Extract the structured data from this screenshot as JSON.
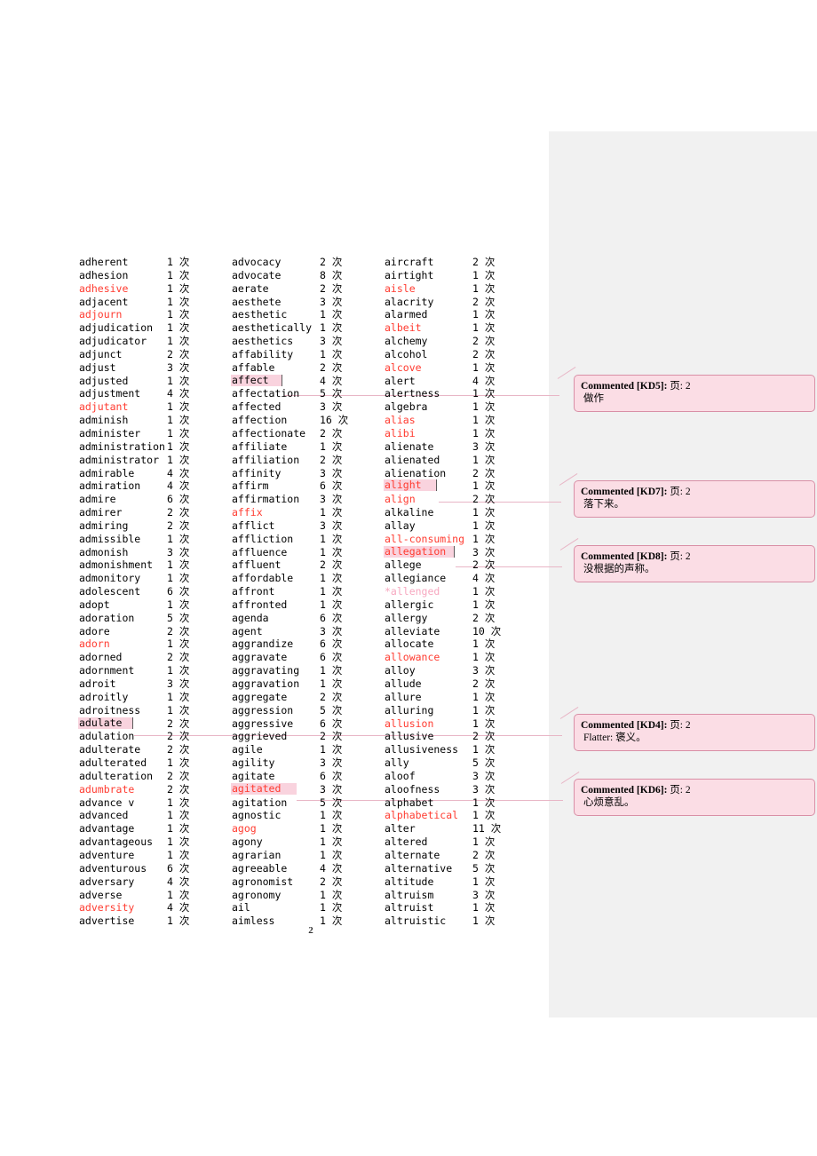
{
  "document": {
    "page_number": "2",
    "count_suffix": "次"
  },
  "columns": [
    {
      "id": "column-1",
      "entries": [
        {
          "term": "adherent",
          "count": "1 次",
          "style": "normal"
        },
        {
          "term": "adhesion",
          "count": "1 次",
          "style": "normal"
        },
        {
          "term": "adhesive",
          "count": "1 次",
          "style": "red"
        },
        {
          "term": "adjacent",
          "count": "1 次",
          "style": "normal"
        },
        {
          "term": "adjourn",
          "count": "1 次",
          "style": "red"
        },
        {
          "term": "adjudication",
          "count": "1 次",
          "style": "normal"
        },
        {
          "term": "adjudicator",
          "count": "1 次",
          "style": "normal"
        },
        {
          "term": "adjunct",
          "count": "2 次",
          "style": "normal"
        },
        {
          "term": "adjust",
          "count": "3 次",
          "style": "normal"
        },
        {
          "term": "adjusted",
          "count": "1 次",
          "style": "normal"
        },
        {
          "term": "adjustment",
          "count": "4 次",
          "style": "normal"
        },
        {
          "term": "adjutant",
          "count": "1 次",
          "style": "red"
        },
        {
          "term": "adminish",
          "count": "1 次",
          "style": "normal"
        },
        {
          "term": "administer",
          "count": "1 次",
          "style": "normal"
        },
        {
          "term": "administration",
          "count": "1 次",
          "style": "normal"
        },
        {
          "term": "administrator",
          "count": "1 次",
          "style": "normal"
        },
        {
          "term": "admirable",
          "count": "4 次",
          "style": "normal"
        },
        {
          "term": "admiration",
          "count": "4 次",
          "style": "normal"
        },
        {
          "term": "admire",
          "count": "6 次",
          "style": "normal"
        },
        {
          "term": "admirer",
          "count": "2 次",
          "style": "normal"
        },
        {
          "term": "admiring",
          "count": "2 次",
          "style": "normal"
        },
        {
          "term": "admissible",
          "count": "1 次",
          "style": "normal"
        },
        {
          "term": "admonish",
          "count": "3 次",
          "style": "normal"
        },
        {
          "term": "admonishment",
          "count": "1 次",
          "style": "normal"
        },
        {
          "term": "admonitory",
          "count": "1 次",
          "style": "normal"
        },
        {
          "term": "adolescent",
          "count": "6 次",
          "style": "normal"
        },
        {
          "term": "adopt",
          "count": "1 次",
          "style": "normal"
        },
        {
          "term": "adoration",
          "count": "5 次",
          "style": "normal"
        },
        {
          "term": "adore",
          "count": "2 次",
          "style": "normal"
        },
        {
          "term": "adorn",
          "count": "1 次",
          "style": "red"
        },
        {
          "term": "adorned",
          "count": "2 次",
          "style": "normal"
        },
        {
          "term": "adornment",
          "count": "1 次",
          "style": "normal"
        },
        {
          "term": "adroit",
          "count": "3 次",
          "style": "normal"
        },
        {
          "term": "adroitly",
          "count": "1 次",
          "style": "normal"
        },
        {
          "term": "adroitness",
          "count": "1 次",
          "style": "normal"
        },
        {
          "term": "adulate",
          "count": "2 次",
          "style": "highlight",
          "hl_width": 62
        },
        {
          "term": "adulation",
          "count": "2 次",
          "style": "normal"
        },
        {
          "term": "adulterate",
          "count": "2 次",
          "style": "normal"
        },
        {
          "term": "adulterated",
          "count": "1 次",
          "style": "normal"
        },
        {
          "term": "adulteration",
          "count": "2 次",
          "style": "normal"
        },
        {
          "term": "adumbrate",
          "count": "2 次",
          "style": "red"
        },
        {
          "term": "advance v",
          "count": "1 次",
          "style": "normal"
        },
        {
          "term": "advanced",
          "count": "1 次",
          "style": "normal"
        },
        {
          "term": "advantage",
          "count": "1 次",
          "style": "normal"
        },
        {
          "term": "advantageous",
          "count": "1 次",
          "style": "normal"
        },
        {
          "term": "adventure",
          "count": "1 次",
          "style": "normal"
        },
        {
          "term": "adventurous",
          "count": "6 次",
          "style": "normal"
        },
        {
          "term": "adversary",
          "count": "4 次",
          "style": "normal"
        },
        {
          "term": "adverse",
          "count": "1 次",
          "style": "normal"
        },
        {
          "term": "adversity",
          "count": "4 次",
          "style": "red"
        },
        {
          "term": "advertise",
          "count": "1 次",
          "style": "normal"
        }
      ]
    },
    {
      "id": "column-2",
      "entries": [
        {
          "term": "advocacy",
          "count": "2 次",
          "style": "normal"
        },
        {
          "term": "advocate",
          "count": "8 次",
          "style": "normal"
        },
        {
          "term": "aerate",
          "count": "2 次",
          "style": "normal"
        },
        {
          "term": "aesthete",
          "count": "3 次",
          "style": "normal"
        },
        {
          "term": "aesthetic",
          "count": "1 次",
          "style": "normal"
        },
        {
          "term": "aesthetically",
          "count": "1 次",
          "style": "normal"
        },
        {
          "term": "aesthetics",
          "count": "3 次",
          "style": "normal"
        },
        {
          "term": "affability",
          "count": "1 次",
          "style": "normal"
        },
        {
          "term": "affable",
          "count": "2 次",
          "style": "normal"
        },
        {
          "term": "affect",
          "count": "4 次",
          "style": "highlight",
          "hl_width": 58
        },
        {
          "term": "affectation",
          "count": "5 次",
          "style": "normal"
        },
        {
          "term": "affected",
          "count": "3 次",
          "style": "normal"
        },
        {
          "term": "affection",
          "count": "16 次",
          "style": "normal"
        },
        {
          "term": "affectionate",
          "count": "2 次",
          "style": "normal"
        },
        {
          "term": "affiliate",
          "count": "1 次",
          "style": "normal"
        },
        {
          "term": "affiliation",
          "count": "2 次",
          "style": "normal"
        },
        {
          "term": "affinity",
          "count": "3 次",
          "style": "normal"
        },
        {
          "term": "affirm",
          "count": "6 次",
          "style": "normal"
        },
        {
          "term": "affirmation",
          "count": "3 次",
          "style": "normal"
        },
        {
          "term": "affix",
          "count": "1 次",
          "style": "red"
        },
        {
          "term": "afflict",
          "count": "3 次",
          "style": "normal"
        },
        {
          "term": "affliction",
          "count": "1 次",
          "style": "normal"
        },
        {
          "term": "affluence",
          "count": "1 次",
          "style": "normal"
        },
        {
          "term": "affluent",
          "count": "2 次",
          "style": "normal"
        },
        {
          "term": "affordable",
          "count": "1 次",
          "style": "normal"
        },
        {
          "term": "affront",
          "count": "1 次",
          "style": "normal"
        },
        {
          "term": "affronted",
          "count": "1 次",
          "style": "normal"
        },
        {
          "term": "agenda",
          "count": "6 次",
          "style": "normal"
        },
        {
          "term": "agent",
          "count": "3 次",
          "style": "normal"
        },
        {
          "term": "aggrandize",
          "count": "6 次",
          "style": "normal"
        },
        {
          "term": "aggravate",
          "count": "6 次",
          "style": "normal"
        },
        {
          "term": "aggravating",
          "count": "1 次",
          "style": "normal"
        },
        {
          "term": "aggravation",
          "count": "1 次",
          "style": "normal"
        },
        {
          "term": "aggregate",
          "count": "2 次",
          "style": "normal"
        },
        {
          "term": "aggression",
          "count": "5 次",
          "style": "normal"
        },
        {
          "term": "aggressive",
          "count": "6 次",
          "style": "normal"
        },
        {
          "term": "aggrieved",
          "count": "2 次",
          "style": "normal"
        },
        {
          "term": "agile",
          "count": "1 次",
          "style": "normal"
        },
        {
          "term": "agility",
          "count": "3 次",
          "style": "normal"
        },
        {
          "term": "agitate",
          "count": "6 次",
          "style": "normal"
        },
        {
          "term": "agitated",
          "count": "3 次",
          "style": "highlight-red",
          "hl_width": 74
        },
        {
          "term": "agitation",
          "count": "5 次",
          "style": "normal"
        },
        {
          "term": "agnostic",
          "count": "1 次",
          "style": "normal"
        },
        {
          "term": "agog",
          "count": "1 次",
          "style": "red"
        },
        {
          "term": "agony",
          "count": "1 次",
          "style": "normal"
        },
        {
          "term": "agrarian",
          "count": "1 次",
          "style": "normal"
        },
        {
          "term": "agreeable",
          "count": "4 次",
          "style": "normal"
        },
        {
          "term": "agronomist",
          "count": "2 次",
          "style": "normal"
        },
        {
          "term": "agronomy",
          "count": "1 次",
          "style": "normal"
        },
        {
          "term": "ail",
          "count": "1 次",
          "style": "normal"
        },
        {
          "term": "aimless",
          "count": "1 次",
          "style": "normal"
        }
      ]
    },
    {
      "id": "column-3",
      "entries": [
        {
          "term": "aircraft",
          "count": "2 次",
          "style": "normal"
        },
        {
          "term": "airtight",
          "count": "1 次",
          "style": "normal"
        },
        {
          "term": "aisle",
          "count": "1 次",
          "style": "red"
        },
        {
          "term": "alacrity",
          "count": "2 次",
          "style": "normal"
        },
        {
          "term": "alarmed",
          "count": "1 次",
          "style": "normal"
        },
        {
          "term": "albeit",
          "count": "1 次",
          "style": "red"
        },
        {
          "term": "alchemy",
          "count": "2 次",
          "style": "normal"
        },
        {
          "term": "alcohol",
          "count": "2 次",
          "style": "normal"
        },
        {
          "term": "alcove",
          "count": "1 次",
          "style": "red"
        },
        {
          "term": "alert",
          "count": "4 次",
          "style": "normal"
        },
        {
          "term": "alertness",
          "count": "1 次",
          "style": "normal"
        },
        {
          "term": "algebra",
          "count": "1 次",
          "style": "normal"
        },
        {
          "term": "alias",
          "count": "1 次",
          "style": "red"
        },
        {
          "term": "alibi",
          "count": "1 次",
          "style": "red"
        },
        {
          "term": "alienate",
          "count": "3 次",
          "style": "normal"
        },
        {
          "term": "alienated",
          "count": "1 次",
          "style": "normal"
        },
        {
          "term": "alienation",
          "count": "2 次",
          "style": "normal"
        },
        {
          "term": "alight",
          "count": "1 次",
          "style": "highlight-red",
          "hl_width": 60
        },
        {
          "term": "align",
          "count": "2 次",
          "style": "red"
        },
        {
          "term": "alkaline",
          "count": "1 次",
          "style": "normal"
        },
        {
          "term": "allay",
          "count": "1 次",
          "style": "normal"
        },
        {
          "term": "all-consuming",
          "count": "1 次",
          "style": "red"
        },
        {
          "term": "allegation",
          "count": "3 次",
          "style": "highlight-red",
          "hl_width": 80
        },
        {
          "term": "allege",
          "count": "2 次",
          "style": "normal"
        },
        {
          "term": "allegiance",
          "count": "4 次",
          "style": "normal"
        },
        {
          "term": "*allenged",
          "count": "1 次",
          "style": "pink"
        },
        {
          "term": "allergic",
          "count": "1 次",
          "style": "normal"
        },
        {
          "term": "allergy",
          "count": "2 次",
          "style": "normal"
        },
        {
          "term": "alleviate",
          "count": "10 次",
          "style": "normal"
        },
        {
          "term": "allocate",
          "count": "1 次",
          "style": "normal"
        },
        {
          "term": "allowance",
          "count": "1 次",
          "style": "red"
        },
        {
          "term": "alloy",
          "count": "3 次",
          "style": "normal"
        },
        {
          "term": "allude",
          "count": "2 次",
          "style": "normal"
        },
        {
          "term": "allure",
          "count": "1 次",
          "style": "normal"
        },
        {
          "term": "alluring",
          "count": "1 次",
          "style": "normal"
        },
        {
          "term": "allusion",
          "count": "1 次",
          "style": "red"
        },
        {
          "term": "allusive",
          "count": "2 次",
          "style": "normal"
        },
        {
          "term": "allusiveness",
          "count": "1 次",
          "style": "normal"
        },
        {
          "term": "ally",
          "count": "5 次",
          "style": "normal"
        },
        {
          "term": "aloof",
          "count": "3 次",
          "style": "normal"
        },
        {
          "term": "aloofness",
          "count": "3 次",
          "style": "normal"
        },
        {
          "term": "alphabet",
          "count": "1 次",
          "style": "normal"
        },
        {
          "term": "alphabetical",
          "count": "1 次",
          "style": "red"
        },
        {
          "term": "alter",
          "count": "11 次",
          "style": "normal"
        },
        {
          "term": "altered",
          "count": "1 次",
          "style": "normal"
        },
        {
          "term": "alternate",
          "count": "2 次",
          "style": "normal"
        },
        {
          "term": "alternative",
          "count": "5 次",
          "style": "normal"
        },
        {
          "term": "altitude",
          "count": "1 次",
          "style": "normal"
        },
        {
          "term": "altruism",
          "count": "3 次",
          "style": "normal"
        },
        {
          "term": "altruist",
          "count": "1 次",
          "style": "normal"
        },
        {
          "term": "altruistic",
          "count": "1 次",
          "style": "normal"
        }
      ]
    }
  ],
  "comments": [
    {
      "id": "KD5",
      "label": "Commented [KD5]:",
      "ref": "页: 2",
      "body": "做作",
      "anchor_term": "affect"
    },
    {
      "id": "KD7",
      "label": "Commented [KD7]:",
      "ref": "页: 2",
      "body": "落下来。",
      "anchor_term": "alight"
    },
    {
      "id": "KD8",
      "label": "Commented [KD8]:",
      "ref": "页: 2",
      "body": "没根据的声称。",
      "anchor_term": "allegation"
    },
    {
      "id": "KD4",
      "label": "Commented [KD4]:",
      "ref": "页: 2",
      "body": "Flatter:  褒义。",
      "anchor_term": "adulate"
    },
    {
      "id": "KD6",
      "label": "Commented [KD6]:",
      "ref": "页: 2",
      "body": "心烦意乱。",
      "anchor_term": "agitated"
    }
  ],
  "colors": {
    "highlight": "#f9d3de",
    "comment_fill": "#fbdde5",
    "comment_border": "#d98fa6",
    "connector": "#e8b6c6",
    "margin_bg": "#f1f1f1",
    "red_text": "#ff3b30",
    "pink_text": "#f7a8c0"
  }
}
